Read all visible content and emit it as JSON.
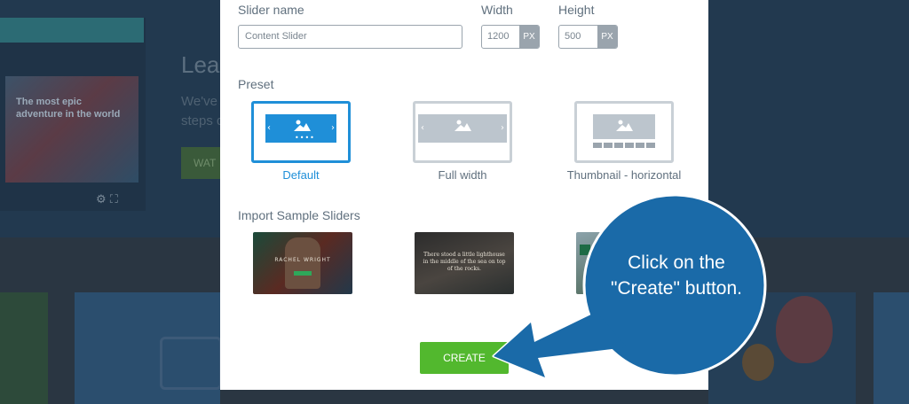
{
  "background": {
    "video_text": "The most epic adventure in the world",
    "heading": "Lea",
    "subtext": "We've steps d",
    "watch_button": "WAT"
  },
  "modal": {
    "slider_name": {
      "label": "Slider name",
      "value": "Content Slider"
    },
    "width": {
      "label": "Width",
      "value": "1200",
      "unit": "PX"
    },
    "height": {
      "label": "Height",
      "value": "500",
      "unit": "PX"
    },
    "preset": {
      "label": "Preset",
      "options": [
        {
          "label": "Default",
          "selected": true
        },
        {
          "label": "Full width",
          "selected": false
        },
        {
          "label": "Thumbnail - horizontal",
          "selected": false
        }
      ]
    },
    "samples": {
      "label": "Import Sample Sliders",
      "items": [
        {
          "text": "RACHEL WRIGHT"
        },
        {
          "text": "There stood a little lighthouse in the middle of the sea on top of the rocks."
        },
        {
          "text": ""
        }
      ]
    },
    "create_button": "CREATE"
  },
  "callout": {
    "text": "Click on the \"Create\" button.",
    "color": "#1a6aa8"
  }
}
